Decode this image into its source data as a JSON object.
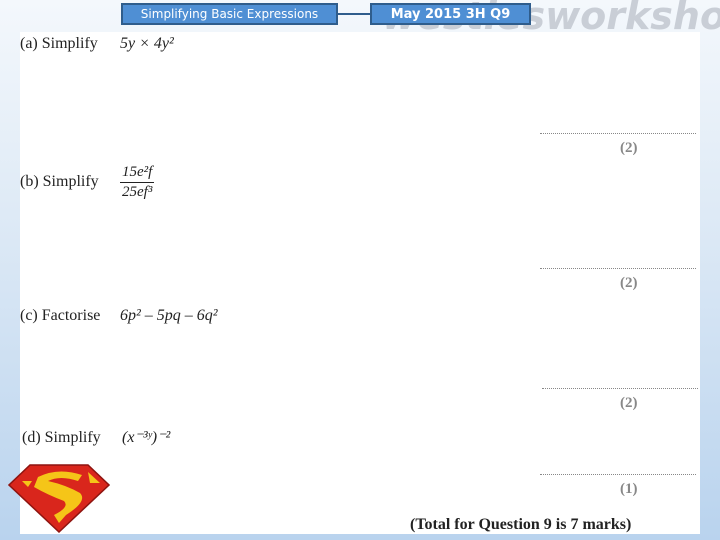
{
  "header": {
    "topic_tag": "Simplifying Basic Expressions",
    "source_tag": "May 2015 3H Q9",
    "watermark": "westiesworkshop"
  },
  "questions": [
    {
      "label": "(a)  Simplify",
      "expression": "5y × 4y²",
      "marks": "(2)"
    },
    {
      "label": "(b)  Simplify",
      "numerator": "15e²f",
      "denominator": "25ef³",
      "marks": "(2)"
    },
    {
      "label": "(c)  Factorise",
      "expression": "6p² – 5pq – 6q²",
      "marks": "(2)"
    },
    {
      "label": "(d)  Simplify",
      "expression": "(x⁻³ʸ)⁻²",
      "marks": "(1)"
    }
  ],
  "total": "(Total for Question 9 is 7 marks)",
  "icons": {
    "logo": "superman-shield-icon"
  }
}
